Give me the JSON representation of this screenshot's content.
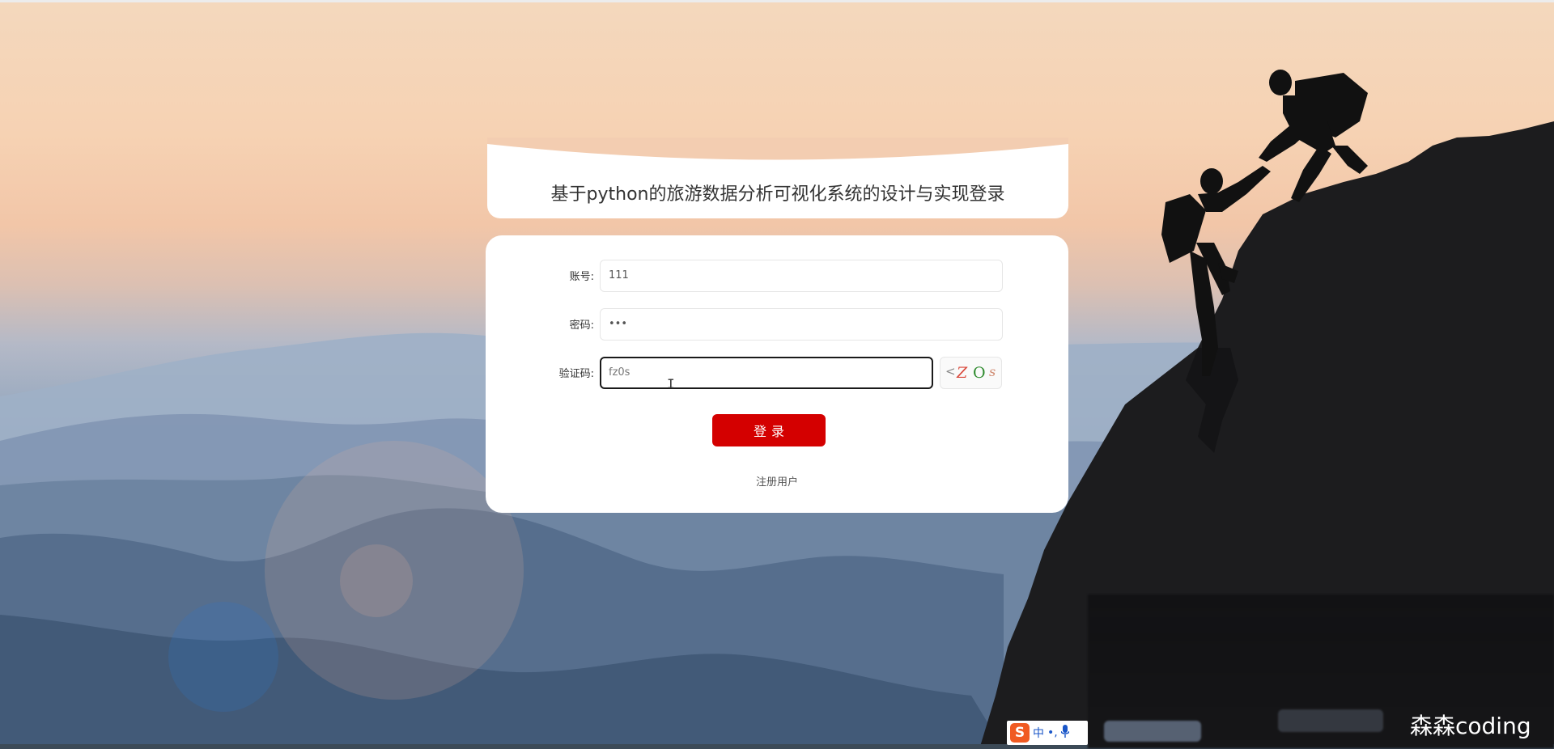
{
  "login": {
    "title": "基于python的旅游数据分析可视化系统的设计与实现登录",
    "account_label": "账号:",
    "account_value": "111",
    "password_label": "密码:",
    "password_value": "•••",
    "captcha_label": "验证码:",
    "captcha_value": "fz0s",
    "captcha_chars": [
      "<",
      "Z",
      "O",
      "s"
    ],
    "submit_label": "登录",
    "register_link": "注册用户"
  },
  "ime": {
    "logo": "S",
    "mode": "中",
    "punct": "•,",
    "icons": [
      "sogou-logo-icon",
      "microphone-icon"
    ]
  },
  "watermark": "森森coding",
  "colors": {
    "primary_button": "#d40000",
    "card": "#ffffff",
    "sky_top": "#f4d8bd",
    "mountain_bottom": "#34485f"
  }
}
